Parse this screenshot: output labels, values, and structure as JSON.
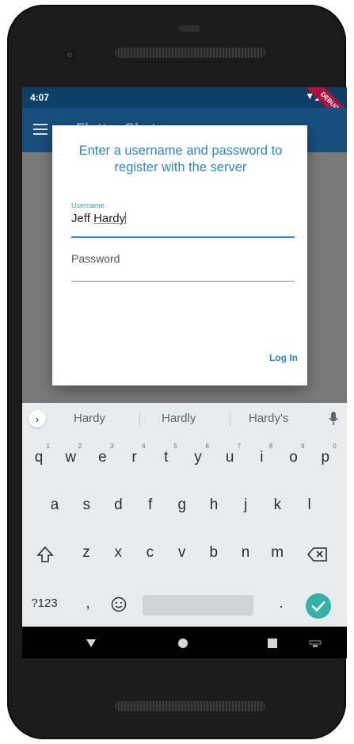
{
  "status_bar": {
    "time": "4:07",
    "icons": "▼◢▮"
  },
  "app_bar": {
    "title": "Flutter Chat",
    "menu_icon": "hamburger-menu-icon",
    "banner": "DEBUG"
  },
  "dialog": {
    "title": "Enter a username and password to register with the server",
    "username": {
      "label": "Username",
      "value_first": "Jeff",
      "value_underlined": "Hardy"
    },
    "password": {
      "placeholder": "Password"
    },
    "login_label": "Log In"
  },
  "keyboard": {
    "suggestions": [
      "Hardy",
      "Hardly",
      "Hardy's"
    ],
    "row1": [
      {
        "k": "q",
        "n": "1"
      },
      {
        "k": "w",
        "n": "2"
      },
      {
        "k": "e",
        "n": "3"
      },
      {
        "k": "r",
        "n": "4"
      },
      {
        "k": "t",
        "n": "5"
      },
      {
        "k": "y",
        "n": "6"
      },
      {
        "k": "u",
        "n": "7"
      },
      {
        "k": "i",
        "n": "8"
      },
      {
        "k": "o",
        "n": "9"
      },
      {
        "k": "p",
        "n": "0"
      }
    ],
    "row2": [
      "a",
      "s",
      "d",
      "f",
      "g",
      "h",
      "j",
      "k",
      "l"
    ],
    "row3": [
      "z",
      "x",
      "c",
      "v",
      "b",
      "n",
      "m"
    ],
    "bottom": {
      "symbols": "?123",
      "comma": ",",
      "period": "."
    }
  },
  "colors": {
    "accent": "#2e86d4",
    "status_bar": "#0f3e68",
    "app_bar": "#174f7c",
    "enter": "#35b2a6",
    "debug": "#b0123c"
  }
}
